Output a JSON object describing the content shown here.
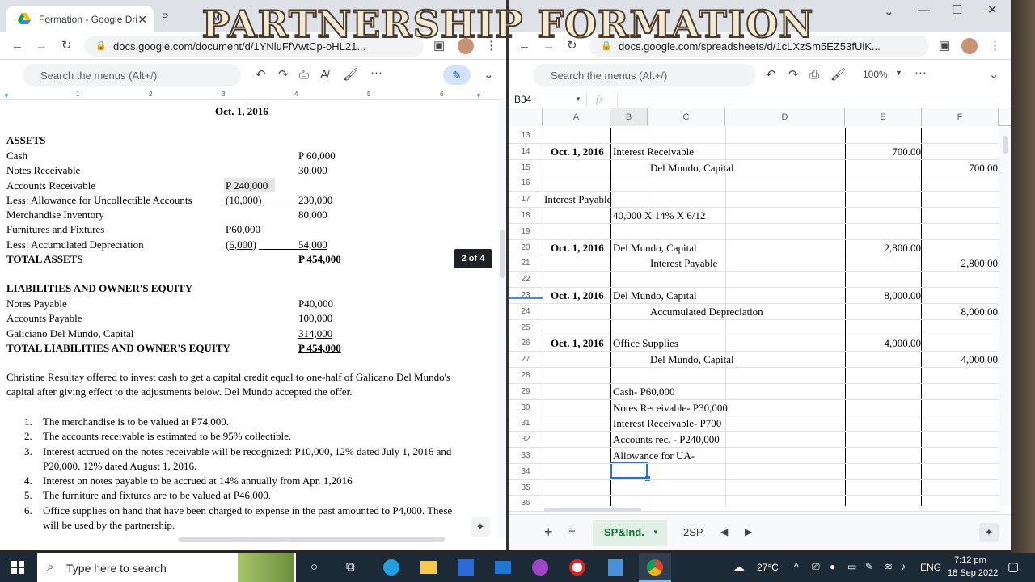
{
  "overlay_title": "PARTNERSHIP FORMATION",
  "left_window": {
    "tab1": "Formation - Google Dri",
    "tab2": "P",
    "tab2_suffix": "M",
    "url": "docs.google.com/document/d/1YNluFfVwtCp-oHL21...",
    "search_menus": "Search the menus (Alt+/)",
    "ruler_marks": [
      "1",
      "2",
      "3",
      "4",
      "5",
      "6"
    ],
    "page_badge": "2 of 4",
    "date_heading": "Oct. 1, 2016",
    "assets_heading": "ASSETS",
    "asset_rows": [
      {
        "label": "Cash",
        "mid": "",
        "amt": "P 60,000"
      },
      {
        "label": "Notes Receivable",
        "mid": "",
        "amt": "30,000"
      },
      {
        "label": "Accounts Receivable",
        "mid": "P 240,000",
        "amt": ""
      },
      {
        "label": "Less: Allowance for Uncollectible Accounts",
        "mid": "(10,000)",
        "amt": "230,000"
      },
      {
        "label": "Merchandise Inventory",
        "mid": "",
        "amt": "80,000"
      },
      {
        "label": "Furnitures and Fixtures",
        "mid": "P60,000",
        "amt": ""
      },
      {
        "label": "Less: Accumulated Depreciation",
        "mid": "(6,000)",
        "amt": "54,000"
      }
    ],
    "total_assets_label": "TOTAL ASSETS",
    "total_assets_amt": "P 454,000",
    "liab_heading": "LIABILITIES AND OWNER'S EQUITY",
    "liab_rows": [
      {
        "label": "Notes Payable",
        "amt": "P40,000"
      },
      {
        "label": "Accounts Payable",
        "amt": "100,000"
      },
      {
        "label": "Galiciano Del Mundo, Capital",
        "amt": "314,000"
      }
    ],
    "total_liab_label": "TOTAL LIABILITIES AND OWNER'S EQUITY",
    "total_liab_amt": "P 454,000",
    "paragraph_line1": "Christine Resultay offered to invest cash to get a capital credit equal to one-half of Galicano Del Mundo's",
    "paragraph_line2": "capital after giving effect to the adjustments below. Del Mundo accepted the offer.",
    "items": [
      {
        "num": "1.",
        "lines": [
          "The merchandise is to be valued at P74,000."
        ]
      },
      {
        "num": "2.",
        "lines": [
          "The accounts receivable is estimated to be 95% collectible."
        ]
      },
      {
        "num": "3.",
        "lines": [
          "Interest accrued on the notes receivable will be recognized: P10,000, 12% dated July 1, 2016 and",
          "P20,000, 12% dated August 1, 2016."
        ]
      },
      {
        "num": "4.",
        "lines": [
          "Interest on notes payable to be accrued at 14% annually from Apr. 1,2016"
        ]
      },
      {
        "num": "5.",
        "lines": [
          "The furniture and fixtures are to be valued at P46,000."
        ]
      },
      {
        "num": "6.",
        "lines": [
          "Office supplies on hand that have been charged to expense in the past amounted to P4,000. These",
          "will be used by the partnership."
        ]
      }
    ]
  },
  "right_window": {
    "url": "docs.google.com/spreadsheets/d/1cLXzSm5EZ53fUiK...",
    "search_menus": "Search the menus (Alt+/)",
    "zoom": "100%",
    "name_box": "B34",
    "fx": "fx",
    "columns": [
      "A",
      "B",
      "C",
      "D",
      "E",
      "F"
    ],
    "rows": [
      {
        "n": "13"
      },
      {
        "n": "14",
        "a": "Oct. 1, 2016",
        "b": "Interest Receivable",
        "e": "700.00"
      },
      {
        "n": "15",
        "c": "Del Mundo, Capital",
        "f": "700.00"
      },
      {
        "n": "16"
      },
      {
        "n": "17",
        "a_plain": "Interest Payable"
      },
      {
        "n": "18",
        "b": "40,000 X 14% X 6/12"
      },
      {
        "n": "19"
      },
      {
        "n": "20",
        "a": "Oct. 1, 2016",
        "b": "Del Mundo, Capital",
        "e": "2,800.00"
      },
      {
        "n": "21",
        "c": "Interest Payable",
        "f": "2,800.00"
      },
      {
        "n": "22"
      },
      {
        "n": "23",
        "a": "Oct. 1, 2016",
        "b": "Del Mundo, Capital",
        "e": "8,000.00"
      },
      {
        "n": "24",
        "c": "Accumulated Depreciation",
        "f": "8,000.00"
      },
      {
        "n": "25"
      },
      {
        "n": "26",
        "a": "Oct. 1, 2016",
        "b": "Office Supplies",
        "e": "4,000.00"
      },
      {
        "n": "27",
        "c": "Del Mundo, Capital",
        "f": "4,000.00"
      },
      {
        "n": "28"
      },
      {
        "n": "29",
        "b": "Cash- P60,000"
      },
      {
        "n": "30",
        "b": "Notes Receivable- P30,000"
      },
      {
        "n": "31",
        "b": "Interest Receivable- P700"
      },
      {
        "n": "32",
        "b": "Accounts rec. - P240,000"
      },
      {
        "n": "33",
        "b": "Allowance for UA-"
      },
      {
        "n": "34"
      },
      {
        "n": "35"
      },
      {
        "n": "36"
      }
    ],
    "sheet_tab_active": "SP&Ind.",
    "sheet_tab_2": "2SP"
  },
  "taskbar": {
    "search_placeholder": "Type here to search",
    "weather": "27°C",
    "lang": "ENG",
    "time": "7:12 pm",
    "date": "18 Sep 2022"
  }
}
